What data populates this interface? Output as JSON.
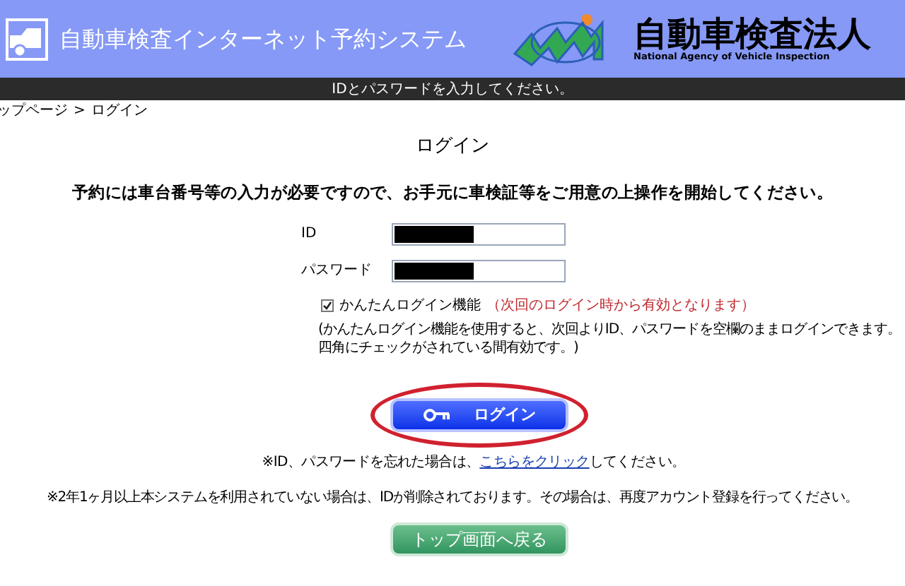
{
  "header": {
    "title": "自動車検査インターネット予約システム",
    "org_name": "自動車検査法人",
    "org_name_en": "National Agency of Vehicle Inspection"
  },
  "message_bar": "IDとパスワードを入力してください。",
  "breadcrumb": [
    "ップページ",
    ">",
    "ログイン"
  ],
  "page_title": "ログイン",
  "instruction": "予約には車台番号等の入力が必要ですので、お手元に車検証等をご用意の上操作を開始してください。",
  "fields": [
    {
      "label": "ID",
      "redacted": true
    },
    {
      "label": "パスワード",
      "redacted": true
    }
  ],
  "easy_login": {
    "label": "かんたんログイン機能",
    "hint": "（次回のログイン時から有効となります）",
    "checked": true
  },
  "easy_login_note": [
    "(かんたんログイン機能を使用すると、次回よりID、パスワードを空欄のままログインできます。",
    "四角にチェックがされている間有効です。)"
  ],
  "login_button": {
    "label": "ログイン",
    "highlighted": true
  },
  "forgot": {
    "before": "※ID、パスワードを忘れた場合は、",
    "link": "こちらをクリック",
    "after": "してください。"
  },
  "notice": "※2年1ヶ月以上本システムを利用されていない場合は、IDが削除されております。その場合は、再度アカウント登録を行ってください。",
  "back_button": "トップ画面へ戻る"
}
